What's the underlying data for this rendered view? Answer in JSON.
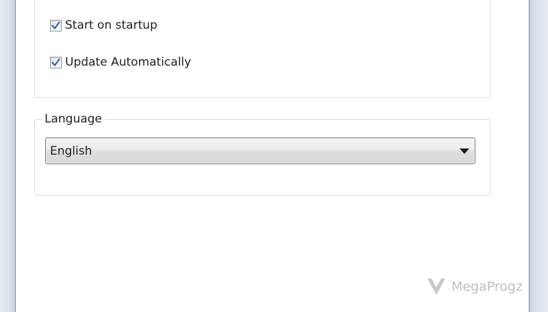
{
  "settings": {
    "options": {
      "start_on_startup": {
        "label": "Start on startup",
        "checked": true
      },
      "update_automatically": {
        "label": "Update Automatically",
        "checked": true
      }
    },
    "language": {
      "legend": "Language",
      "selected": "English"
    }
  },
  "watermark": {
    "text": "MegaProgz",
    "icon": "megaprogz-logo-icon"
  },
  "colors": {
    "check": "#2b5fb8",
    "frame": "#dbe3ec",
    "group_border": "#d5dfe5"
  }
}
